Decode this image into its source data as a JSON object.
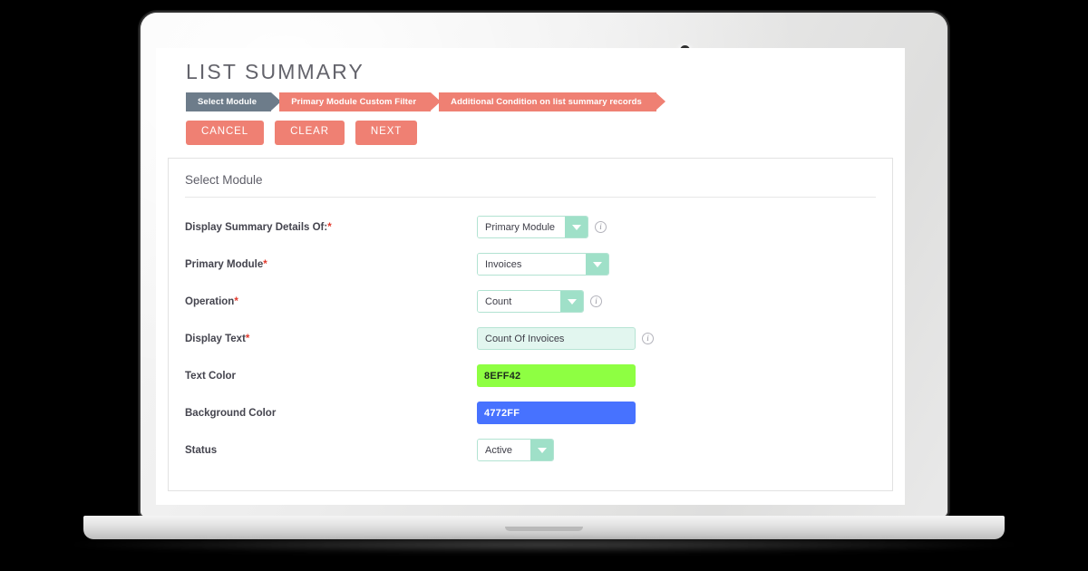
{
  "page": {
    "title": "LIST SUMMARY"
  },
  "steps": [
    {
      "label": "Select Module",
      "state": "active"
    },
    {
      "label": "Primary Module Custom Filter",
      "state": "pending"
    },
    {
      "label": "Additional Condition on list summary records",
      "state": "pending"
    }
  ],
  "buttons": [
    {
      "label": "CANCEL",
      "name": "cancel-button"
    },
    {
      "label": "CLEAR",
      "name": "clear-button"
    },
    {
      "label": "NEXT",
      "name": "next-button"
    }
  ],
  "panel": {
    "heading": "Select Module",
    "fields": [
      {
        "label": "Display Summary Details Of:",
        "required": true,
        "type": "select",
        "value": "Primary Module",
        "info": true
      },
      {
        "label": "Primary Module",
        "required": true,
        "type": "select",
        "value": "Invoices",
        "info": false
      },
      {
        "label": "Operation",
        "required": true,
        "type": "select",
        "value": "Count",
        "info": true
      },
      {
        "label": "Display Text",
        "required": true,
        "type": "text",
        "value": "Count Of Invoices",
        "info": true
      },
      {
        "label": "Text Color",
        "required": false,
        "type": "color",
        "value": "8EFF42",
        "swatch": "#8EFF42",
        "info": false
      },
      {
        "label": "Background Color",
        "required": false,
        "type": "color",
        "value": "4772FF",
        "swatch": "#4772FF",
        "info": false
      },
      {
        "label": "Status",
        "required": false,
        "type": "select",
        "value": "Active",
        "info": false
      }
    ]
  },
  "theme": {
    "accent_coral": "#EF8073",
    "active_step": "#6D7C8A",
    "mint": "#9FE0C8",
    "mint_field": "#E2F6EF",
    "required_asterisk": "#E23B2E",
    "title_color": "#63636B"
  },
  "icons": {
    "info": "i",
    "dropdown_arrow": "▼"
  }
}
